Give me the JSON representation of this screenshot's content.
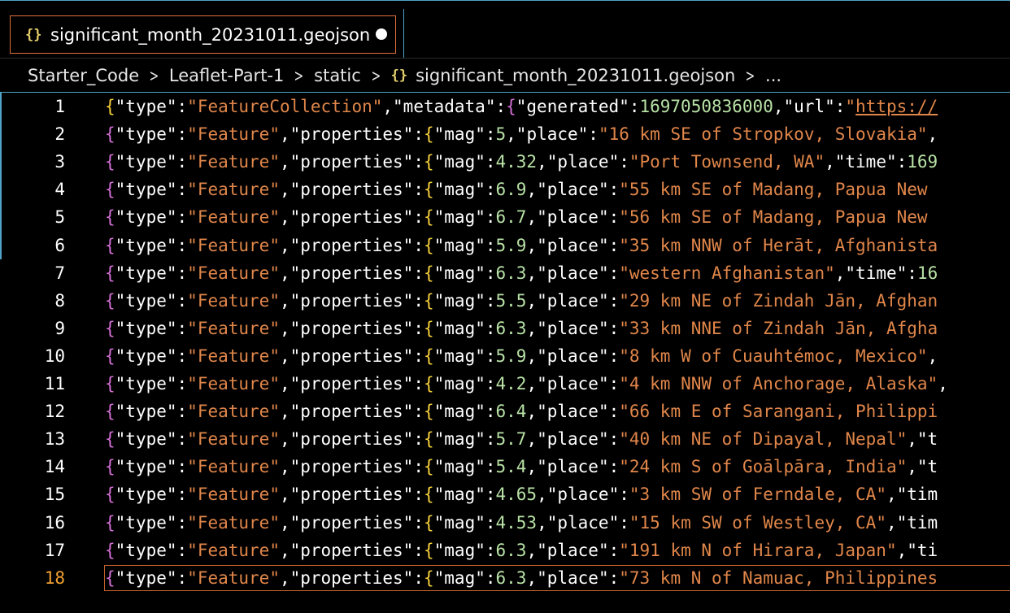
{
  "tab": {
    "icon": "{}",
    "icon_name": "json-braces-icon",
    "label": "significant_month_20231011.geojson",
    "dirty_indicator": "unsaved-dot-icon"
  },
  "breadcrumb": {
    "items": [
      "Starter_Code",
      "Leaflet-Part-1",
      "static"
    ],
    "file_icon": "{}",
    "file": "significant_month_20231011.geojson",
    "ellipsis": "...",
    "separator": ">"
  },
  "editor": {
    "active_line": 18,
    "colors": {
      "bracket_outer": "#f7d23c",
      "bracket_inner": "#d670d6",
      "string": "#e0864a",
      "number": "#b8e2a6",
      "active_line_number": "#f0a030",
      "accent": "#4fa3c7"
    },
    "lines": [
      {
        "n": "1",
        "mag": null,
        "place": null
      },
      {
        "n": "2",
        "mag": "5",
        "place": "16 km SE of Stropkov, Slovakia",
        "tail": "\","
      },
      {
        "n": "3",
        "mag": "4.32",
        "place": "Port Townsend, WA",
        "tail": "\",\"time\":169"
      },
      {
        "n": "4",
        "mag": "6.9",
        "place": "55 km SE of Madang, Papua New",
        "tail": ""
      },
      {
        "n": "5",
        "mag": "6.7",
        "place": "56 km SE of Madang, Papua New",
        "tail": ""
      },
      {
        "n": "6",
        "mag": "5.9",
        "place": "35 km NNW of Herāt, Afghanista",
        "tail": ""
      },
      {
        "n": "7",
        "mag": "6.3",
        "place": "western Afghanistan",
        "tail": "\",\"time\":16"
      },
      {
        "n": "8",
        "mag": "5.5",
        "place": "29 km NE of Zindah Jān, Afghan",
        "tail": ""
      },
      {
        "n": "9",
        "mag": "6.3",
        "place": "33 km NNE of Zindah Jān, Afgha",
        "tail": ""
      },
      {
        "n": "10",
        "mag": "5.9",
        "place": "8 km W of Cuauhtémoc, Mexico",
        "tail": "\","
      },
      {
        "n": "11",
        "mag": "4.2",
        "place": "4 km NNW of Anchorage, Alaska",
        "tail": "\","
      },
      {
        "n": "12",
        "mag": "6.4",
        "place": "66 km E of Sarangani, Philippi",
        "tail": ""
      },
      {
        "n": "13",
        "mag": "5.7",
        "place": "40 km NE of Dipayal, Nepal",
        "tail": "\",\"t"
      },
      {
        "n": "14",
        "mag": "5.4",
        "place": "24 km S of Goālpāra, India",
        "tail": "\",\"t"
      },
      {
        "n": "15",
        "mag": "4.65",
        "place": "3 km SW of Ferndale, CA",
        "tail": "\",\"tim"
      },
      {
        "n": "16",
        "mag": "4.53",
        "place": "15 km SW of Westley, CA",
        "tail": "\",\"tim"
      },
      {
        "n": "17",
        "mag": "6.3",
        "place": "191 km N of Hirara, Japan",
        "tail": "\",\"ti"
      },
      {
        "n": "18",
        "mag": "6.3",
        "place": "73 km N of Namuac, Philippines",
        "tail": ""
      }
    ],
    "line1": {
      "type_value": "FeatureCollection",
      "generated": "1697050836000",
      "url_fragment": "https://"
    },
    "feature_type": "Feature"
  }
}
